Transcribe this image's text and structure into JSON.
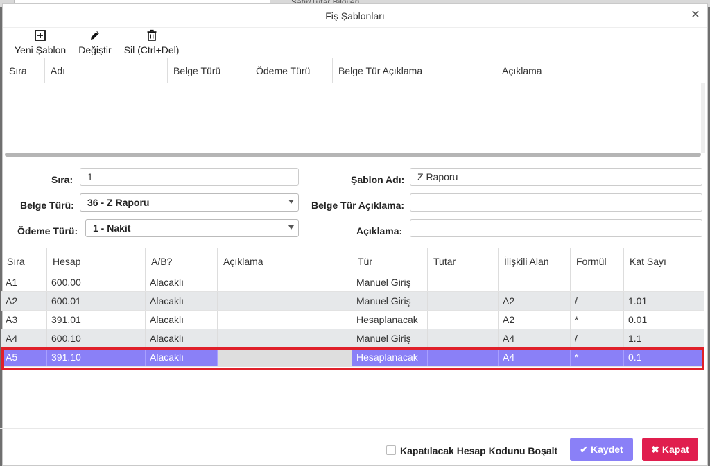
{
  "background": {
    "partial_title": "Satır/Tutar Bilgileri"
  },
  "dialog": {
    "title": "Fiş Şablonları",
    "close_icon": "close-icon"
  },
  "toolbar": {
    "new_label": "Yeni Şablon",
    "edit_label": "Değiştir",
    "delete_label": "Sil (Ctrl+Del)"
  },
  "templates_grid": {
    "columns": [
      "Sıra",
      "Adı",
      "Belge Türü",
      "Ödeme Türü",
      "Belge Tür Açıklama",
      "Açıklama"
    ]
  },
  "form": {
    "sira_label": "Sıra:",
    "sira_value": "1",
    "belge_turu_label": "Belge Türü:",
    "belge_turu_value": "36 - Z Raporu",
    "odeme_turu_label": "Ödeme Türü:",
    "odeme_turu_value": "1 - Nakit",
    "sablon_adi_label": "Şablon Adı:",
    "sablon_adi_value": "Z Raporu",
    "belge_tur_aciklama_label": "Belge Tür Açıklama:",
    "belge_tur_aciklama_value": "",
    "aciklama_label": "Açıklama:",
    "aciklama_value": ""
  },
  "lines_grid": {
    "columns": [
      "Sıra",
      "Hesap",
      "A/B?",
      "Açıklama",
      "Tür",
      "Tutar",
      "İlişkili Alan",
      "Formül",
      "Kat Sayı"
    ],
    "rows": [
      [
        "A1",
        "600.00",
        "Alacaklı",
        "",
        "Manuel Giriş",
        "",
        "",
        "",
        ""
      ],
      [
        "A2",
        "600.01",
        "Alacaklı",
        "",
        "Manuel Giriş",
        "",
        "A2",
        "/",
        "1.01"
      ],
      [
        "A3",
        "391.01",
        "Alacaklı",
        "",
        "Hesaplanacak",
        "",
        "A2",
        "*",
        "0.01"
      ],
      [
        "A4",
        "600.10",
        "Alacaklı",
        "",
        "Manuel Giriş",
        "",
        "A4",
        "/",
        "1.1"
      ],
      [
        "A5",
        "391.10",
        "Alacaklı",
        "",
        "Hesaplanacak",
        "",
        "A4",
        "*",
        "0.1"
      ]
    ],
    "selected_row": 4
  },
  "footer": {
    "clear_checkbox_label": "Kapatılacak Hesap Kodunu Boşalt",
    "save_label": "Kaydet",
    "close_label": "Kapat"
  },
  "colors": {
    "accent": "#8a80f7",
    "danger": "#e01e4e",
    "highlight": "#e0202a"
  }
}
